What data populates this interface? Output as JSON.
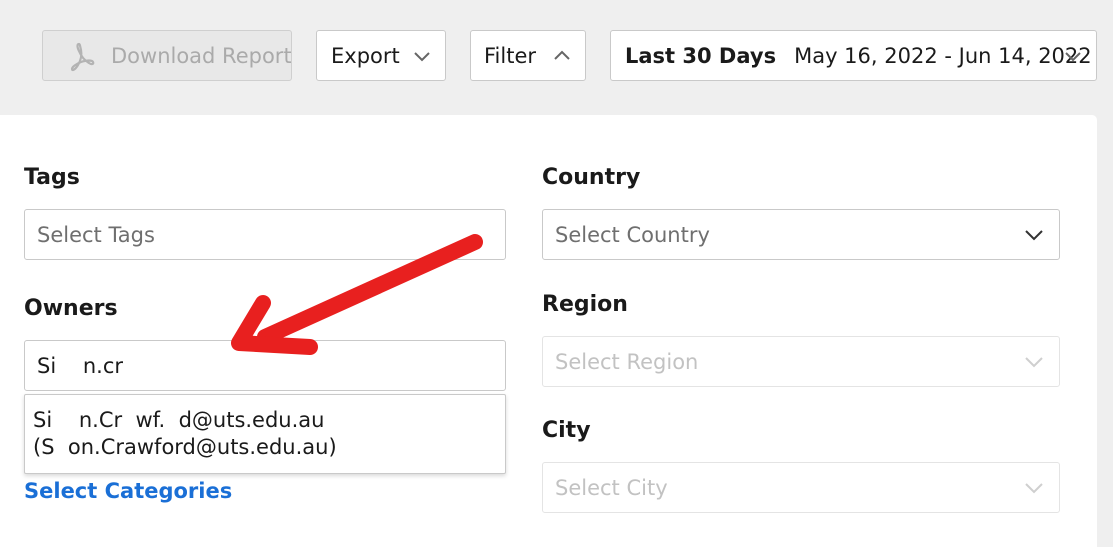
{
  "toolbar": {
    "download_label": "Download Report",
    "export_label": "Export",
    "filter_label": "Filter",
    "date_range_label": "Last 30 Days",
    "date_range_value": "May 16, 2022 - Jun 14, 2022"
  },
  "filters": {
    "tags": {
      "label": "Tags",
      "placeholder": "Select Tags"
    },
    "owners": {
      "label": "Owners",
      "value": "Si    n.cr"
    },
    "owner_suggestion": {
      "line1": "Si    n.Cr  wf.  d@uts.edu.au",
      "line2": "(S  on.Crawford@uts.edu.au)"
    },
    "categories_link": "Select Categories",
    "country": {
      "label": "Country",
      "placeholder": "Select Country"
    },
    "region": {
      "label": "Region",
      "placeholder": "Select Region"
    },
    "city": {
      "label": "City",
      "placeholder": "Select City"
    }
  },
  "icons": {
    "download": "pdf-icon",
    "dropdown": "chevron-down-icon",
    "collapse": "chevron-up-icon"
  },
  "colors": {
    "accent_link": "#1a6fd6",
    "annotation_arrow": "#e8201f"
  }
}
